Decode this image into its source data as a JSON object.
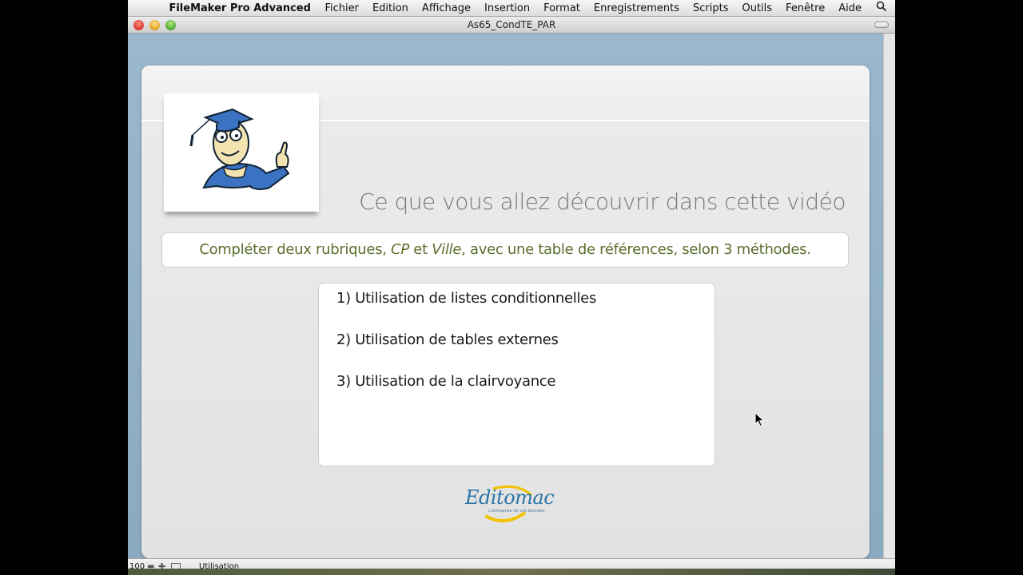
{
  "menubar": {
    "app_name": "FileMaker Pro Advanced",
    "items": [
      "Fichier",
      "Edition",
      "Affichage",
      "Insertion",
      "Format",
      "Enregistrements",
      "Scripts",
      "Outils",
      "Fenêtre",
      "Aide"
    ],
    "apple_icon": "apple-icon",
    "spotlight_icon": "search-icon"
  },
  "window": {
    "title": "As65_CondTE_PAR"
  },
  "layout": {
    "heading": "Ce que vous allez découvrir dans cette vidéo",
    "subtitle": {
      "part1": "Compléter deux rubriques, ",
      "cp": "CP",
      "part2": " et ",
      "ville": "Ville",
      "part3": ", avec une table de références, selon 3 méthodes."
    },
    "methods": [
      "1) Utilisation de listes conditionnelles",
      "2) Utilisation de tables externes",
      "3) Utilisation de la clairvoyance"
    ],
    "logo_text": "Editomac",
    "logo_tagline": "L'entreprise de vos données"
  },
  "statusbar": {
    "zoom": "100",
    "mode": "Utilisation"
  },
  "colors": {
    "subtitle_green": "#5a6e2c",
    "canvas_blue": "#8fb0c8",
    "logo_blue": "#2a74a6",
    "logo_yellow": "#f2c200"
  }
}
